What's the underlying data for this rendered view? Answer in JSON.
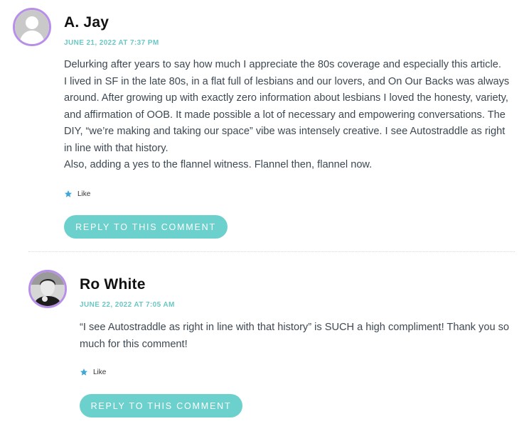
{
  "colors": {
    "accent_teal": "#6cd0cc",
    "date_teal": "#6bc7c4",
    "avatar_ring": "#b78fe8"
  },
  "comments": [
    {
      "author": "A. Jay",
      "date": "JUNE 21, 2022 AT 7:37 PM",
      "avatar_icon": "default-user-avatar",
      "paragraphs": [
        "Delurking after years to say how much I appreciate the 80s coverage and especially this article.",
        "I lived in SF in the late 80s, in a flat full of lesbians and our lovers, and On Our Backs was always around. After growing up with exactly zero information about lesbians I loved the honesty, variety, and affirmation of OOB. It made possible a lot of necessary and empowering conversations. The DIY, “we’re making and taking our space” vibe was intensely creative. I see Autostraddle as right in line with that history.",
        "Also, adding a yes to the flannel witness. Flannel then, flannel now."
      ],
      "like_label": "Like",
      "reply_label": "REPLY TO THIS COMMENT"
    },
    {
      "author": "Ro White",
      "date": "JUNE 22, 2022 AT 7:05 AM",
      "avatar_icon": "user-photo-avatar",
      "paragraphs": [
        "“I see Autostraddle as right in line with that history” is SUCH a high compliment! Thank you so much for this comment!"
      ],
      "like_label": "Like",
      "reply_label": "REPLY TO THIS COMMENT"
    }
  ]
}
